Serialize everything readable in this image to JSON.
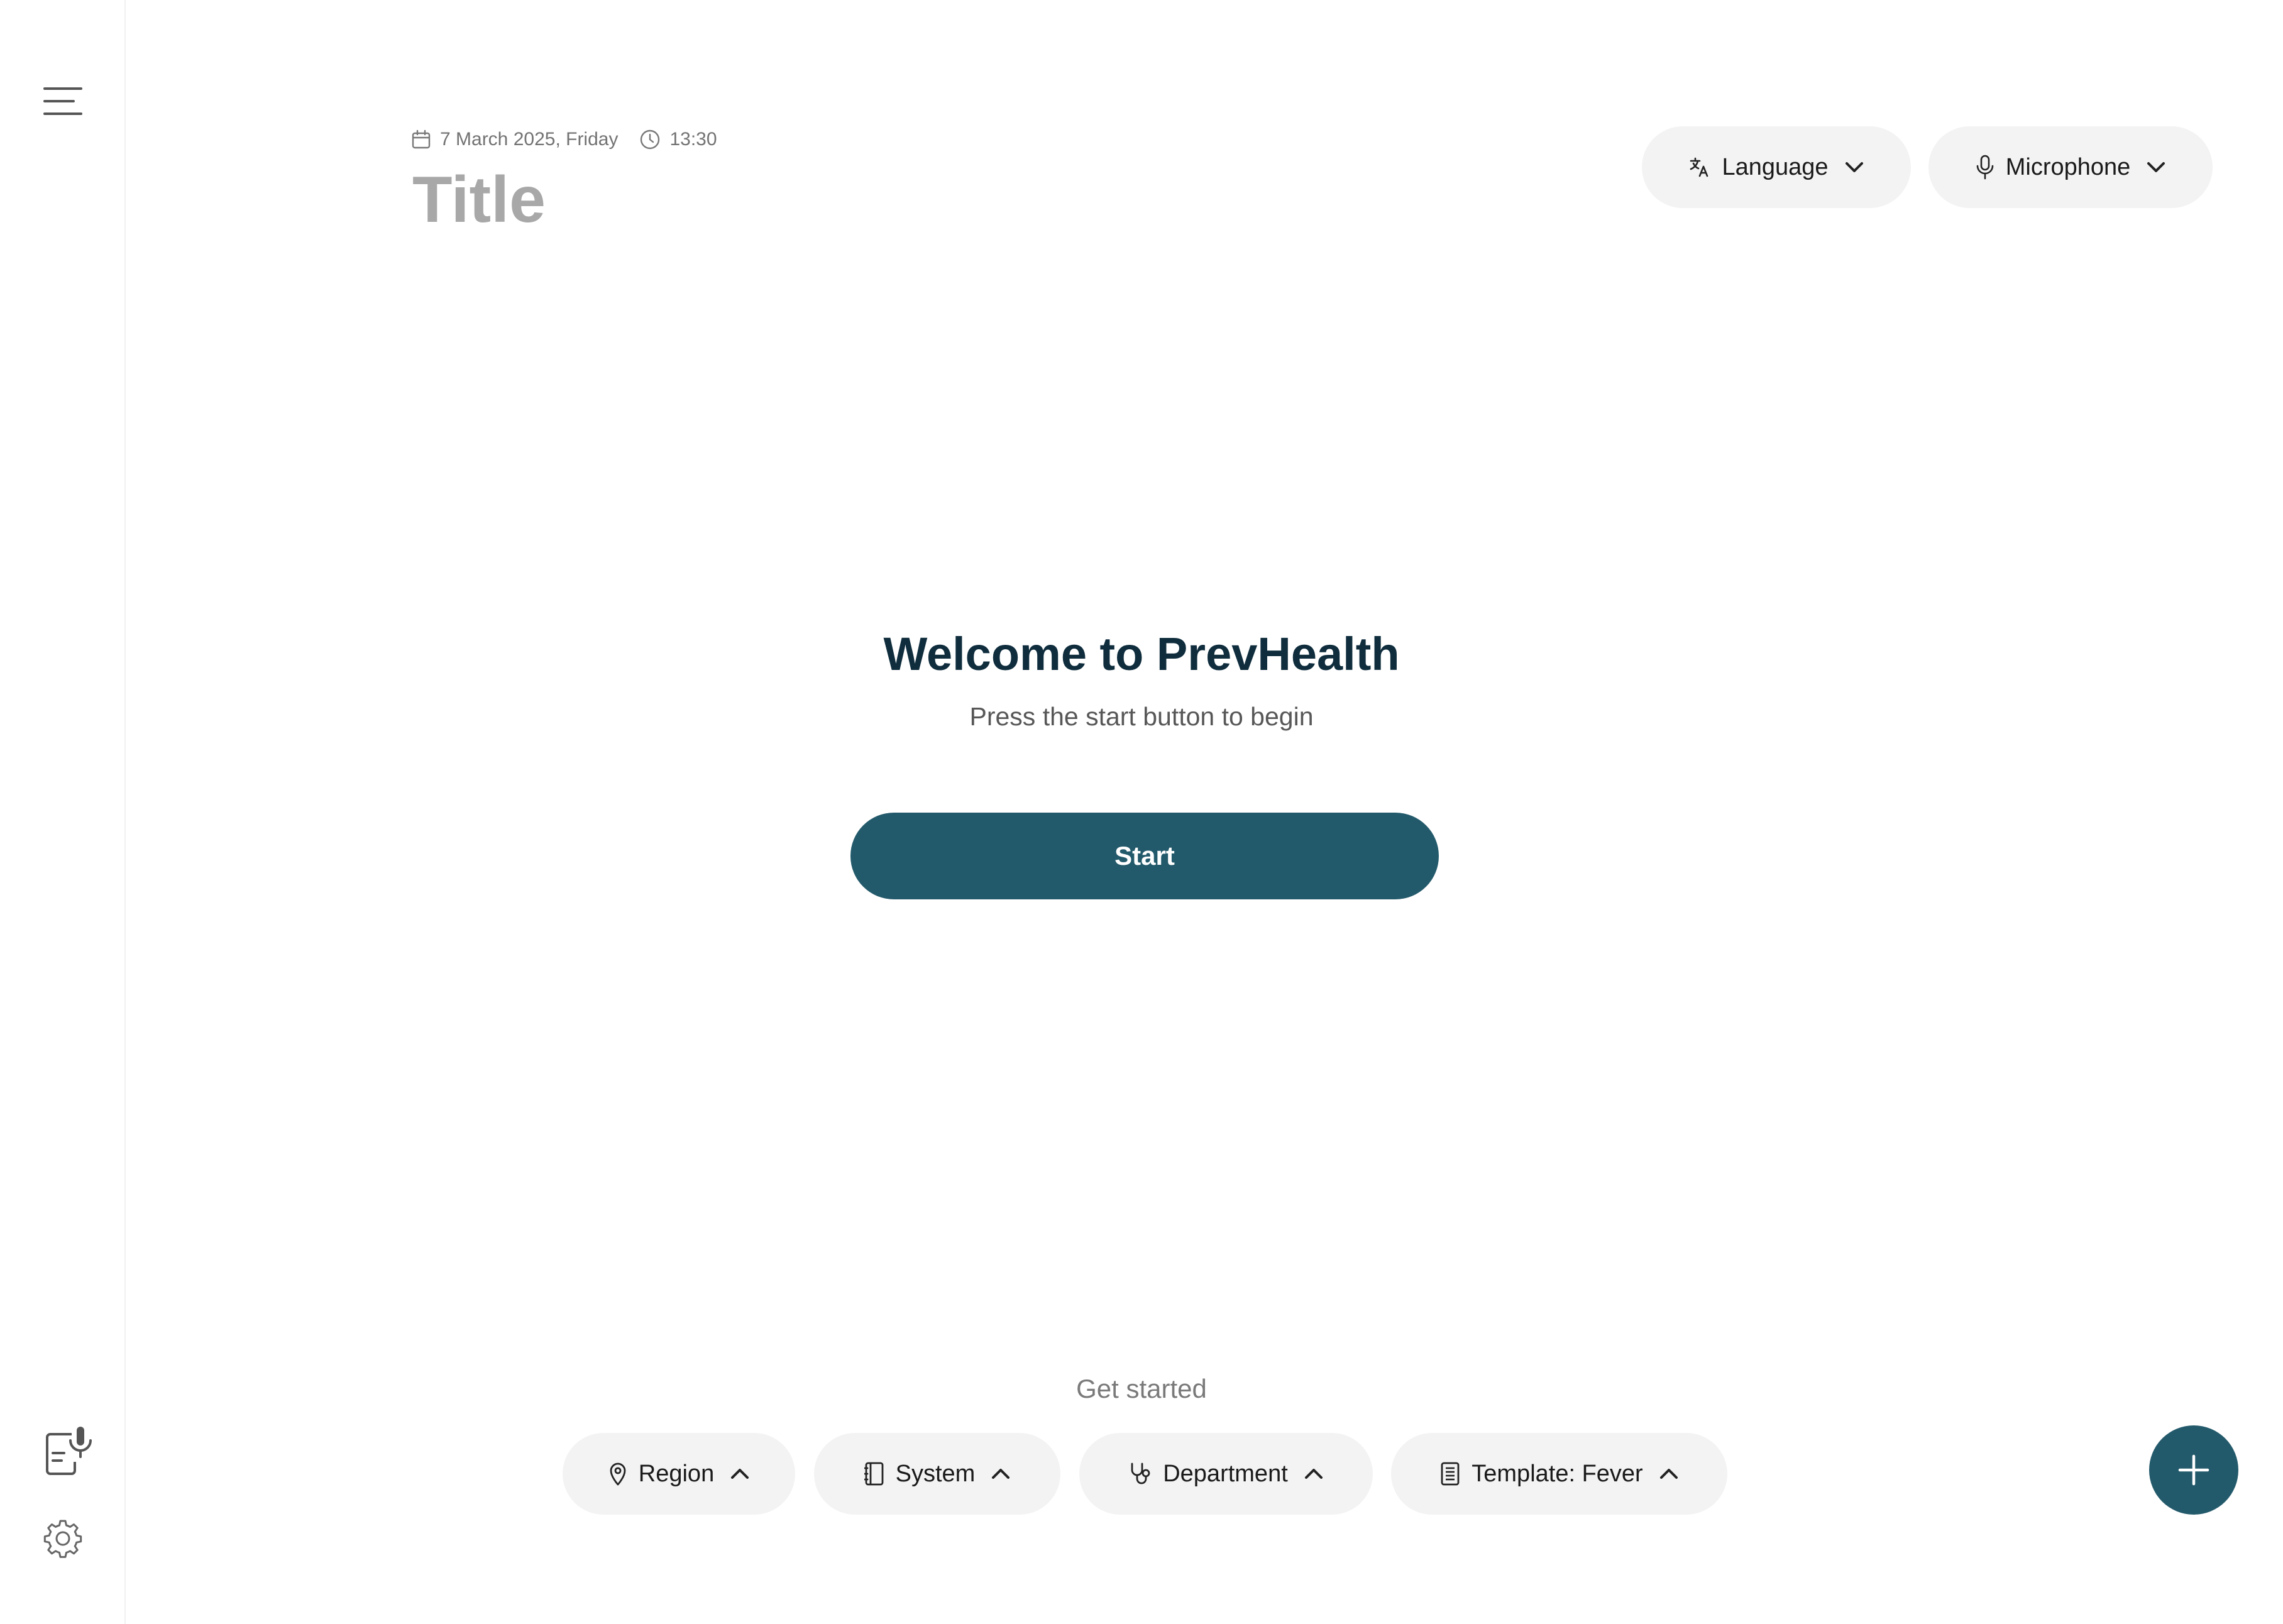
{
  "sidebar": {
    "menu_icon": "hamburger-menu-icon",
    "dictation_icon": "document-microphone-icon",
    "settings_icon": "gear-icon"
  },
  "header": {
    "date": "7 March 2025, Friday",
    "time": "13:30",
    "title": "Title",
    "language_label": "Language",
    "microphone_label": "Microphone"
  },
  "main": {
    "welcome_heading": "Welcome to PrevHealth",
    "welcome_subtitle": "Press the start button to begin",
    "start_label": "Start"
  },
  "footer": {
    "get_started": "Get started",
    "filters": {
      "region": "Region",
      "system": "System",
      "department": "Department",
      "template": "Template: Fever"
    }
  },
  "colors": {
    "brand": "#235a6b",
    "heading": "#0f2d3d",
    "pill_bg": "#f3f3f3",
    "title_placeholder": "#a8a8a8"
  }
}
